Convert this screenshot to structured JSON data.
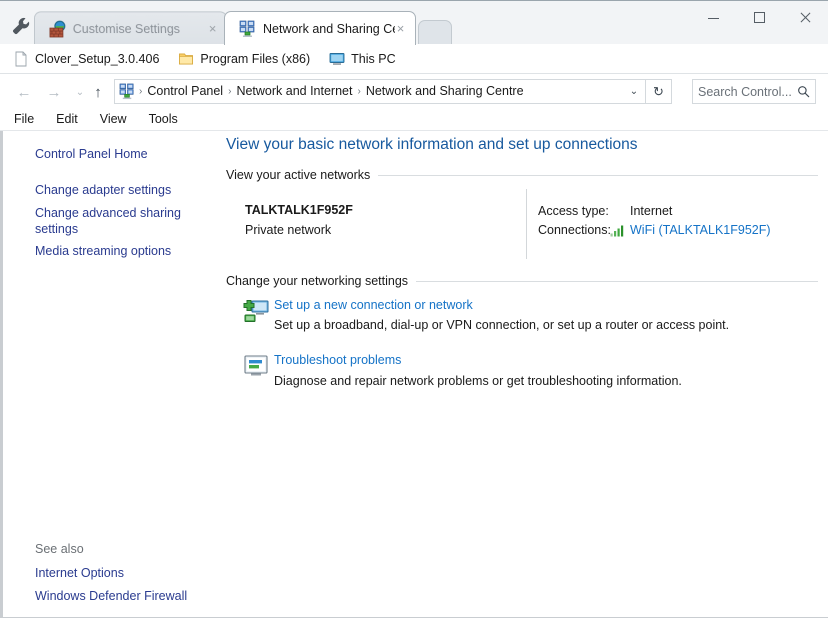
{
  "window": {
    "caption_buttons": [
      {
        "name": "minimize",
        "glyph": "minimize-icon"
      },
      {
        "name": "maximize",
        "glyph": "maximize-icon"
      },
      {
        "name": "close",
        "glyph": "close-icon"
      }
    ]
  },
  "tabs": {
    "tool_icon": "wrench-icon",
    "items": [
      {
        "label": "Customise Settings",
        "icon": "customise-settings-icon",
        "active": false,
        "close": "×"
      },
      {
        "label": "Network and Sharing Centr",
        "icon": "network-sharing-icon",
        "active": true,
        "close": "×"
      }
    ],
    "new_tab_label": ""
  },
  "bookmarks": [
    {
      "label": "Clover_Setup_3.0.406",
      "icon": "file-icon"
    },
    {
      "label": "Program Files (x86)",
      "icon": "folder-icon"
    },
    {
      "label": "This PC",
      "icon": "this-pc-icon"
    }
  ],
  "addressbar": {
    "back": "←",
    "forward": "→",
    "history": "⌄",
    "up": "↑",
    "crumb_icon": "network-sharing-icon",
    "breadcrumbs": [
      "Control Panel",
      "Network and Internet",
      "Network and Sharing Centre"
    ],
    "separator": "›",
    "dropdown": "⌄",
    "refresh": "↻",
    "search_placeholder": "Search Control...",
    "search_value": "",
    "search_icon": "search-icon"
  },
  "menubar": {
    "items": [
      "File",
      "Edit",
      "View",
      "Tools"
    ]
  },
  "sidebar": {
    "home": "Control Panel Home",
    "links": [
      "Change adapter settings",
      "Change advanced sharing settings",
      "Media streaming options"
    ],
    "see_also_title": "See also",
    "see_also": [
      "Internet Options",
      "Windows Defender Firewall"
    ]
  },
  "main": {
    "heading": "View your basic network information and set up connections",
    "active_networks_heading": "View your active networks",
    "network": {
      "name": "TALKTALK1F952F",
      "type": "Private network",
      "access_type_label": "Access type:",
      "access_type_value": "Internet",
      "connections_label": "Connections:",
      "connection_link": "WiFi (TALKTALK1F952F)",
      "connection_icon": "wifi-signal-icon"
    },
    "change_settings_heading": "Change your networking settings",
    "tasks": [
      {
        "icon": "new-connection-icon",
        "link": "Set up a new connection or network",
        "description": "Set up a broadband, dial-up or VPN connection, or set up a router or access point."
      },
      {
        "icon": "troubleshoot-icon",
        "link": "Troubleshoot problems",
        "description": "Diagnose and repair network problems or get troubleshooting information."
      }
    ]
  },
  "colors": {
    "heading_blue": "#17599e",
    "link_blue": "#1573c7",
    "sidebar_link": "#2a3b8f",
    "wifi_green": "#3aa83a"
  }
}
